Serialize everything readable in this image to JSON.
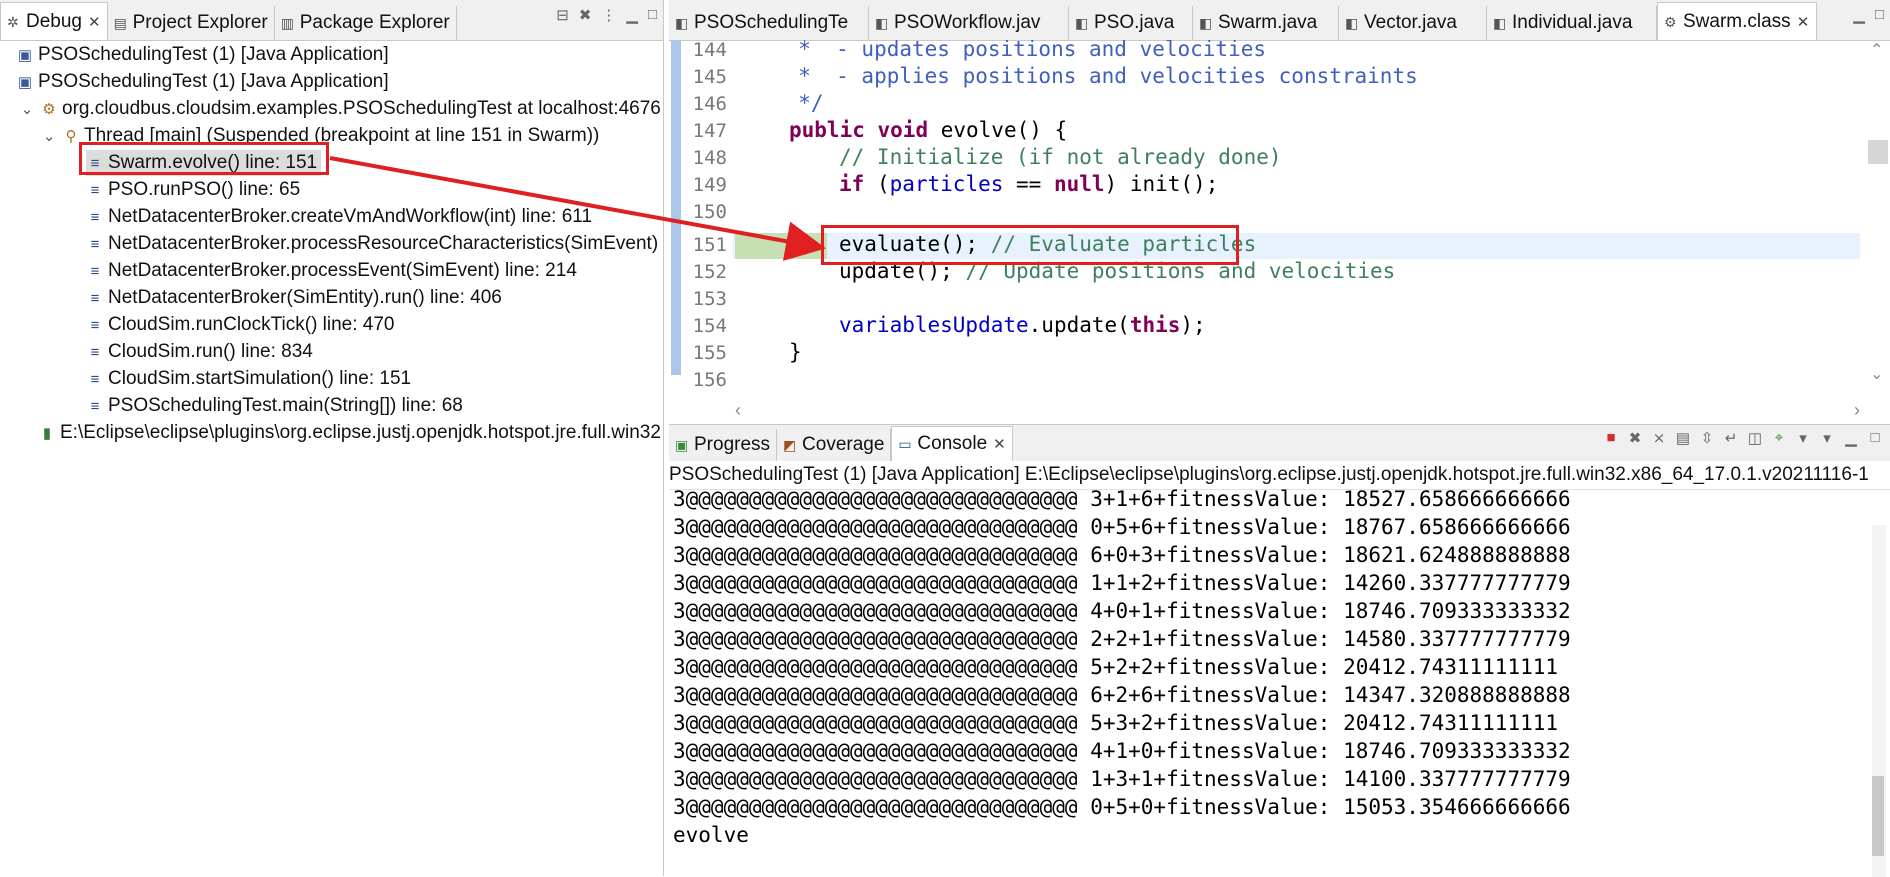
{
  "left_panel": {
    "tabs": [
      {
        "label": "Debug",
        "icon": "debug-icon",
        "active": true
      },
      {
        "label": "Project Explorer",
        "icon": "project-explorer-icon"
      },
      {
        "label": "Package Explorer",
        "icon": "package-explorer-icon"
      }
    ],
    "tree": [
      {
        "label": "PSOSchedulingTest (1) [Java Application]",
        "icon": "java-application-icon",
        "indent": 0
      },
      {
        "label": "PSOSchedulingTest (1) [Java Application]",
        "icon": "java-application-icon",
        "indent": 0,
        "expanded": true
      },
      {
        "label": "org.cloudbus.cloudsim.examples.PSOSchedulingTest at localhost:4676",
        "icon": "debug-target-icon",
        "indent": 1,
        "expanded": true
      },
      {
        "label": "Thread [main] (Suspended (breakpoint at line 151 in Swarm))",
        "icon": "suspended-thread-icon",
        "indent": 2,
        "expanded": true
      },
      {
        "label": "Swarm.evolve() line: 151",
        "icon": "stack-frame-icon",
        "indent": 3,
        "selected": true
      },
      {
        "label": "PSO.runPSO() line: 65",
        "icon": "stack-frame-icon",
        "indent": 3
      },
      {
        "label": "NetDatacenterBroker.createVmAndWorkflow(int) line: 611",
        "icon": "stack-frame-icon",
        "indent": 3
      },
      {
        "label": "NetDatacenterBroker.processResourceCharacteristics(SimEvent)",
        "icon": "stack-frame-icon",
        "indent": 3
      },
      {
        "label": "NetDatacenterBroker.processEvent(SimEvent) line: 214",
        "icon": "stack-frame-icon",
        "indent": 3
      },
      {
        "label": "NetDatacenterBroker(SimEntity).run() line: 406",
        "icon": "stack-frame-icon",
        "indent": 3
      },
      {
        "label": "CloudSim.runClockTick() line: 470",
        "icon": "stack-frame-icon",
        "indent": 3
      },
      {
        "label": "CloudSim.run() line: 834",
        "icon": "stack-frame-icon",
        "indent": 3
      },
      {
        "label": "CloudSim.startSimulation() line: 151",
        "icon": "stack-frame-icon",
        "indent": 3
      },
      {
        "label": "PSOSchedulingTest.main(String[]) line: 68",
        "icon": "stack-frame-icon",
        "indent": 3
      },
      {
        "label": "E:\\Eclipse\\eclipse\\plugins\\org.eclipse.justj.openjdk.hotspot.jre.full.win32",
        "icon": "jvm-process-icon",
        "indent": 1
      }
    ]
  },
  "editor": {
    "tabs": [
      {
        "label": "PSOSchedulingTe",
        "icon": "java-file-icon"
      },
      {
        "label": "PSOWorkflow.jav",
        "icon": "java-file-icon"
      },
      {
        "label": "PSO.java",
        "icon": "java-file-icon"
      },
      {
        "label": "Swarm.java",
        "icon": "java-file-icon"
      },
      {
        "label": "Vector.java",
        "icon": "java-file-icon"
      },
      {
        "label": "Individual.java",
        "icon": "java-file-icon"
      },
      {
        "label": "Swarm.class",
        "icon": "class-file-icon",
        "active": true
      }
    ],
    "line_numbers": [
      "144",
      "145",
      "146",
      "147",
      "148",
      "149",
      "150",
      "151",
      "152",
      "153",
      "154",
      "155",
      "156"
    ],
    "lines": {
      "l144": "     *  - updates positions and velocities",
      "l145": "     *  - applies positions and velocities constraints",
      "l146": "     */",
      "l147a": "public",
      "l147b": "void",
      "l147c": " evolve() {",
      "l148": "// Initialize (if not already done)",
      "l149a": "if",
      "l149b": " (",
      "l149c": "particles",
      "l149d": " == ",
      "l149e": "null",
      "l149f": ") init();",
      "l151a": "evaluate(); ",
      "l151b": "// Evaluate particles",
      "l152a": "update(); ",
      "l152b": "// Update positions and velocities",
      "l154a": "variablesUpdate",
      "l154b": ".update(",
      "l154c": "this",
      "l154d": ");",
      "l155": "}"
    }
  },
  "console_panel": {
    "tabs": [
      {
        "label": "Progress",
        "icon": "progress-icon"
      },
      {
        "label": "Coverage",
        "icon": "coverage-icon"
      },
      {
        "label": "Console",
        "icon": "console-icon",
        "active": true
      }
    ],
    "header": "PSOSchedulingTest (1) [Java Application] E:\\Eclipse\\eclipse\\plugins\\org.eclipse.justj.openjdk.hotspot.jre.full.win32.x86_64_17.0.1.v20211116-1",
    "output": [
      "3@@@@@@@@@@@@@@@@@@@@@@@@@@@@@@@ 3+1+6+fitnessValue: 18527.658666666666",
      "3@@@@@@@@@@@@@@@@@@@@@@@@@@@@@@@ 0+5+6+fitnessValue: 18767.658666666666",
      "3@@@@@@@@@@@@@@@@@@@@@@@@@@@@@@@ 6+0+3+fitnessValue: 18621.624888888888",
      "3@@@@@@@@@@@@@@@@@@@@@@@@@@@@@@@ 1+1+2+fitnessValue: 14260.337777777779",
      "3@@@@@@@@@@@@@@@@@@@@@@@@@@@@@@@ 4+0+1+fitnessValue: 18746.709333333332",
      "3@@@@@@@@@@@@@@@@@@@@@@@@@@@@@@@ 2+2+1+fitnessValue: 14580.337777777779",
      "3@@@@@@@@@@@@@@@@@@@@@@@@@@@@@@@ 5+2+2+fitnessValue: 20412.74311111111",
      "3@@@@@@@@@@@@@@@@@@@@@@@@@@@@@@@ 6+2+6+fitnessValue: 14347.320888888888",
      "3@@@@@@@@@@@@@@@@@@@@@@@@@@@@@@@ 5+3+2+fitnessValue: 20412.74311111111",
      "3@@@@@@@@@@@@@@@@@@@@@@@@@@@@@@@ 4+1+0+fitnessValue: 18746.709333333332",
      "3@@@@@@@@@@@@@@@@@@@@@@@@@@@@@@@ 1+3+1+fitnessValue: 14100.337777777779",
      "3@@@@@@@@@@@@@@@@@@@@@@@@@@@@@@@ 0+5+0+fitnessValue: 15053.354666666666",
      "evolve"
    ]
  },
  "colors": {
    "annotation_red": "#e02020",
    "keyword": "#7f0055",
    "comment": "#3f7f5f",
    "javadoc": "#3f5fbf",
    "field": "#0000c0",
    "current_line_green": "#c6e0b4"
  }
}
